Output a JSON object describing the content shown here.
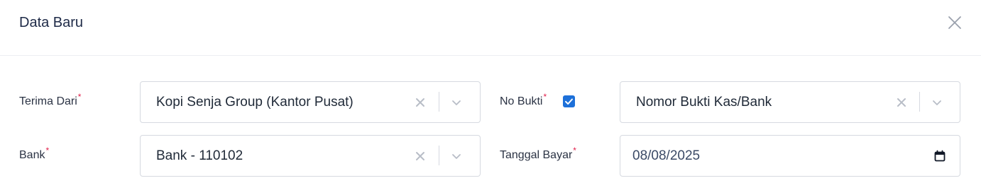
{
  "dialog": {
    "title": "Data Baru",
    "close_icon": "close-icon"
  },
  "form": {
    "terima_dari": {
      "label": "Terima Dari",
      "required_mark": "*",
      "value": "Kopi Senja Group (Kantor Pusat)"
    },
    "bank": {
      "label": "Bank",
      "required_mark": "*",
      "value": "Bank - 110102"
    },
    "no_bukti": {
      "label": "No Bukti",
      "required_mark": "*",
      "auto_checked": true,
      "value": "Nomor Bukti Kas/Bank"
    },
    "tanggal_bayar": {
      "label": "Tanggal Bayar",
      "required_mark": "*",
      "value": "08/08/2025"
    }
  },
  "colors": {
    "accent": "#1d70d9",
    "required": "#e11d48",
    "border": "#d6d9e0",
    "title": "#1e2a47"
  }
}
